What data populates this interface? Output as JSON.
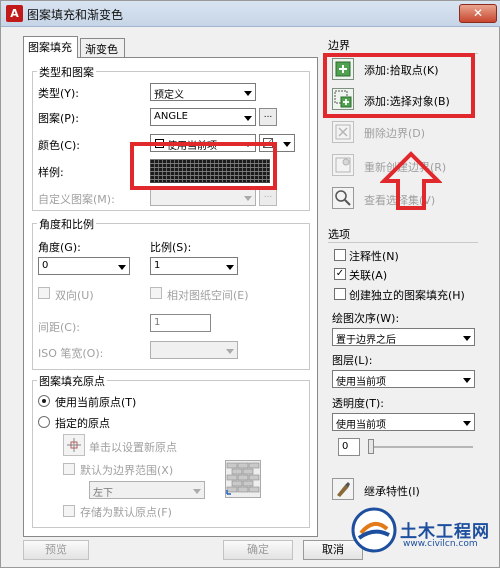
{
  "window": {
    "title": "图案填充和渐变色",
    "app_icon": "A",
    "close": "✕"
  },
  "tabs": [
    {
      "label": "图案填充",
      "active": true
    },
    {
      "label": "渐变色",
      "active": false
    }
  ],
  "type_pattern": {
    "group_label": "类型和图案",
    "type_label": "类型(Y):",
    "type_value": "预定义",
    "pattern_label": "图案(P):",
    "pattern_value": "ANGLE",
    "pattern_btn": "...",
    "color_label": "颜色(C):",
    "color_value": "使用当前项",
    "swatch_label": "样例:",
    "custom_label": "自定义图案(M):",
    "custom_btn": "..."
  },
  "angle_scale": {
    "group_label": "角度和比例",
    "angle_label": "角度(G):",
    "angle_value": "0",
    "scale_label": "比例(S):",
    "scale_value": "1",
    "double_label": "双向(U)",
    "relative_label": "相对图纸空间(E)",
    "spacing_label": "间距(C):",
    "spacing_value": "1",
    "iso_label": "ISO 笔宽(O):"
  },
  "origin": {
    "group_label": "图案填充原点",
    "use_current_label": "使用当前原点(T)",
    "specify_label": "指定的原点",
    "click_set_label": "单击以设置新原点",
    "default_extent_label": "默认为边界范围(X)",
    "position_value": "左下",
    "store_label": "存储为默认原点(F)"
  },
  "boundary": {
    "group_label": "边界",
    "add_pick_label": "添加:拾取点(K)",
    "add_select_label": "添加:选择对象(B)",
    "remove_label": "删除边界(D)",
    "recreate_label": "重新创建边界(R)",
    "view_label": "查看选择集(V)"
  },
  "options": {
    "group_label": "选项",
    "annotative_label": "注释性(N)",
    "annotative_checked": false,
    "associative_label": "关联(A)",
    "associative_checked": true,
    "separate_label": "创建独立的图案填充(H)",
    "separate_checked": false,
    "draw_order_label": "绘图次序(W):",
    "draw_order_value": "置于边界之后",
    "layer_label": "图层(L):",
    "layer_value": "使用当前项",
    "transparency_label": "透明度(T):",
    "transparency_value": "使用当前项",
    "transparency_amount": "0",
    "inherit_label": "继承特性(I)"
  },
  "footer": {
    "preview": "预览",
    "ok": "确定",
    "cancel": "取消"
  },
  "watermark": {
    "name": "土木工程网",
    "url": "www.civilcn.com"
  },
  "colors": {
    "highlight": "#e0282d",
    "swatch_bg": "#1a1a1a"
  }
}
